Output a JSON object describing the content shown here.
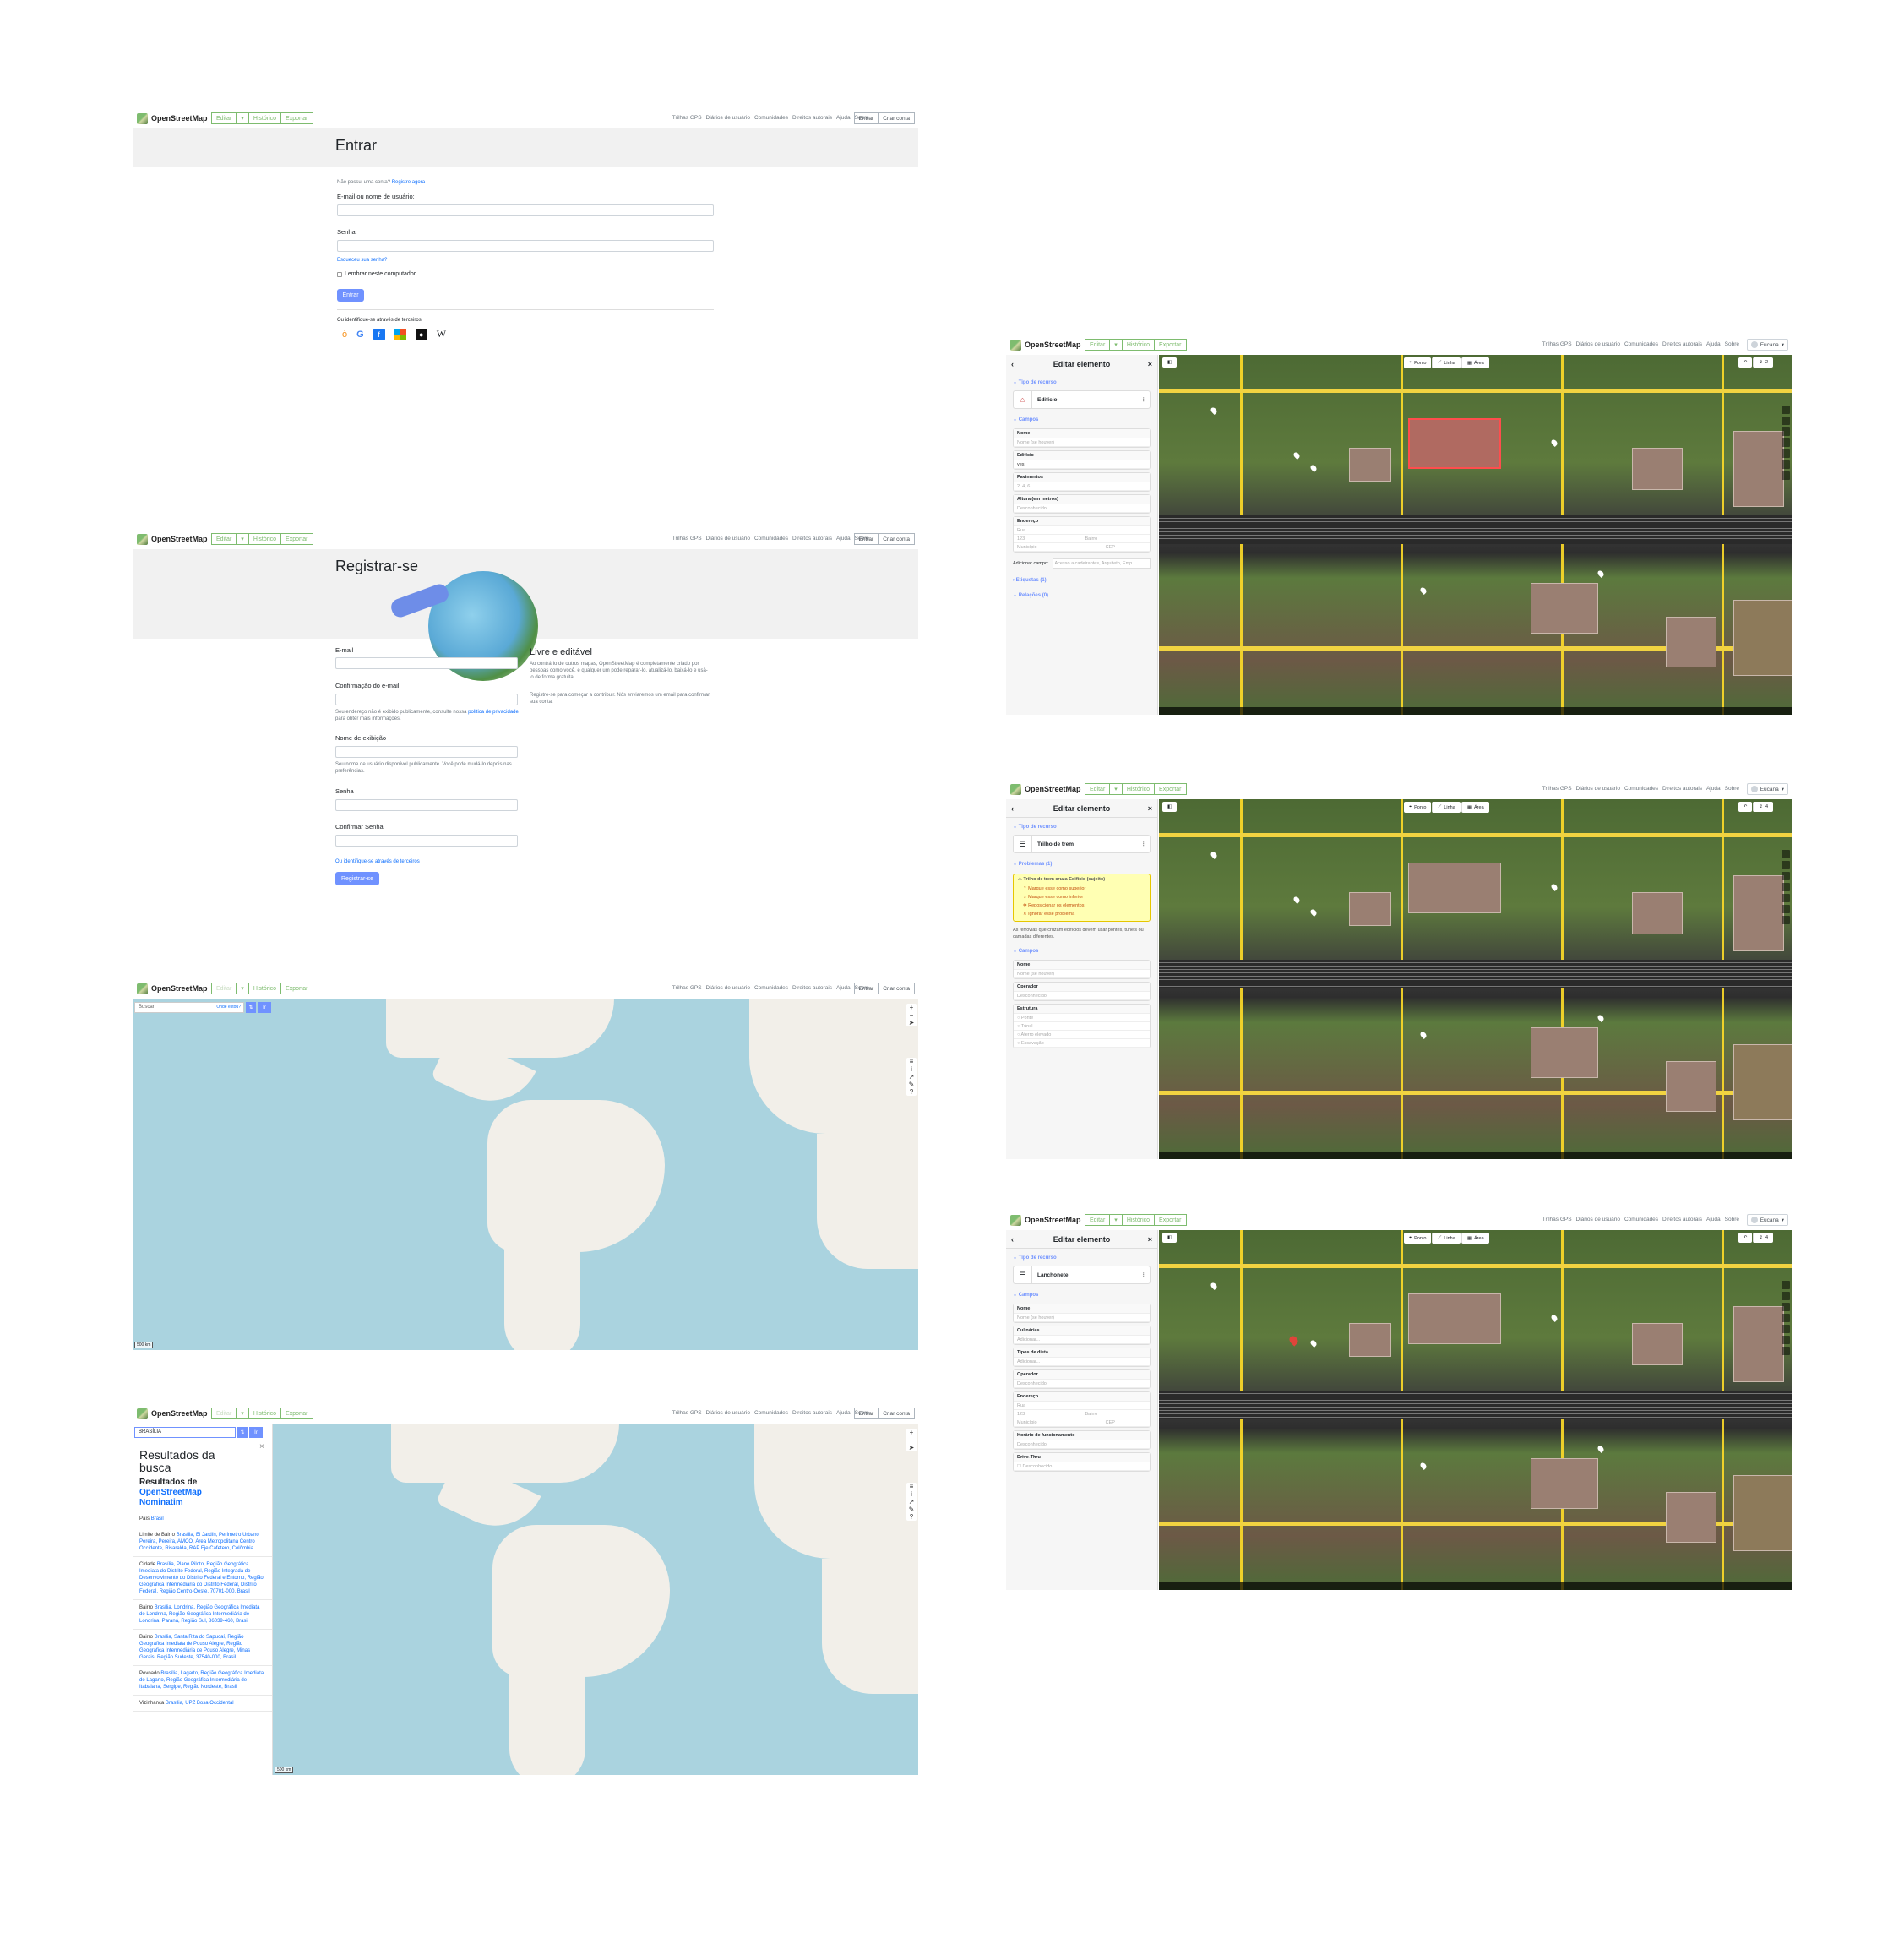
{
  "osm": {
    "brand": "OpenStreetMap",
    "edit": "Editar",
    "history": "Histórico",
    "export": "Exportar",
    "nav": [
      "Trilhas GPS",
      "Diários de usuário",
      "Comunidades",
      "Direitos autorais",
      "Ajuda",
      "Sobre"
    ],
    "login": "Entrar",
    "create_account": "Criar conta",
    "user": "Eucana"
  },
  "login_page": {
    "title": "Entrar",
    "no_account": "Não possui uma conta?",
    "register_now": "Registre agora",
    "email_label": "E-mail ou nome de usuário:",
    "password_label": "Senha:",
    "forgot": "Esqueceu sua senha?",
    "remember": "Lembrar neste computador",
    "submit": "Entrar",
    "third_party": "Ou identifique-se através de terceiros:"
  },
  "register_page": {
    "title": "Registrar-se",
    "email_label": "E-mail",
    "confirm_email_label": "Confirmação do e-mail",
    "email_help": "Seu endereço não é exibido publicamente, consulte nossa",
    "privacy_link": "política de privacidade",
    "email_help2": "para obter mais informações.",
    "display_name_label": "Nome de exibição",
    "display_name_help": "Seu nome de usuário disponível publicamente. Você pode mudá-lo depois nas preferências.",
    "password_label": "Senha",
    "confirm_password_label": "Confirmar Senha",
    "third_party": "Ou identifique-se através de terceiros",
    "submit": "Registrar-se",
    "aside_title": "Livre e editável",
    "aside_p1": "Ao contrário de outros mapas, OpenStreetMap é completamente criado por pessoas como você, e qualquer um pode reparar-lo, atualizá-lo, baixá-lo e usá-lo de forma gratuita.",
    "aside_p2": "Registre-se para começar a contribuir. Nós enviaremos um email para confirmar sua conta."
  },
  "map_page": {
    "search_placeholder": "Buscar",
    "where_am_i": "Onde estou?",
    "go": "Ir",
    "scale": "500 km"
  },
  "search_page": {
    "query": "BRASÍLIA",
    "go": "Ir",
    "heading": "Resultados da busca",
    "source_prefix": "Resultados de",
    "source": "OpenStreetMap Nominatim",
    "results": [
      {
        "type": "País",
        "text": "Brasil"
      },
      {
        "type": "Limite de Bairro",
        "text": "Brasília, El Jardín, Perímetro Urbano Pereira, Pereira, AMCO, Área Metropolitana Centro Occidente, Risaralda, RAP Eje Cafetero, Colômbia"
      },
      {
        "type": "Cidade",
        "text": "Brasília, Plano Piloto, Região Geográfica Imediata do Distrito Federal, Região Integrada de Desenvolvimento do Distrito Federal e Entorno, Região Geográfica Intermediária do Distrito Federal, Distrito Federal, Região Centro-Oeste, 70701-000, Brasil"
      },
      {
        "type": "Bairro",
        "text": "Brasília, Londrina, Região Geográfica Imediata de Londrina, Região Geográfica Intermediária de Londrina, Paraná, Região Sul, 86039-460, Brasil"
      },
      {
        "type": "Bairro",
        "text": "Brasília, Santa Rita do Sapucaí, Região Geográfica Imediata de Pouso Alegre, Região Geográfica Intermediária de Pouso Alegre, Minas Gerais, Região Sudeste, 37540-000, Brasil"
      },
      {
        "type": "Povoado",
        "text": "Brasília, Lagarto, Região Geográfica Imediata de Lagarto, Região Geográfica Intermediária de Itabaiana, Sergipe, Região Nordeste, Brasil"
      },
      {
        "type": "Vizinhança",
        "text": "Brasília, UPZ Bosa Occidental"
      }
    ],
    "scale": "500 km"
  },
  "editor": {
    "title": "Editar elemento",
    "feature_type": "Tipo de recurso",
    "fields": "Campos",
    "point": "Ponto",
    "line": "Linha",
    "area": "Área",
    "save": "Salvar",
    "undo": "Desfazer",
    "add_element": "Adicionar elemento",
    "building_panel": {
      "preset": "Edifício",
      "name_label": "Nome",
      "name_placeholder": "Nome (se houver)",
      "building_label": "Edifício",
      "building_value": "yes",
      "levels_label": "Pavimentos",
      "levels_placeholder": "2, 4, 6...",
      "height_label": "Altura (em metros)",
      "height_placeholder": "Desconhecido",
      "address_label": "Endereço",
      "street_placeholder": "Rua",
      "number_placeholder": "123",
      "neighbourhood_placeholder": "Bairro",
      "city_placeholder": "Município",
      "postcode_placeholder": "CEP",
      "add_field_label": "Adicionar campo:",
      "add_field_placeholder": "Acesso a cadeirantes, Arquiteto, Emp...",
      "tags": "Etiquetas (1)",
      "relations": "Relações (0)",
      "save_count": "2"
    },
    "rail_panel": {
      "preset": "Trilho de trem",
      "issues": "Problemas (1)",
      "issue_title": "Trilho de trem cruza Edifício (sujeito)",
      "fixes": [
        "Marque esse como superior",
        "Marque esse como inferior",
        "Reposicionar os elementos",
        "Ignorar esse problema"
      ],
      "issue_help": "As ferrovias que cruzam edifícios devem usar pontes, túneis ou camadas diferentes.",
      "name_label": "Nome",
      "name_placeholder": "Nome (se houver)",
      "operator_label": "Operador",
      "operator_placeholder": "Desconhecido",
      "structure_label": "Estrutura",
      "structures": [
        "Ponte",
        "Túnel",
        "Aterro elevado",
        "Escavação"
      ],
      "save_count": "4"
    },
    "snack_panel": {
      "preset": "Lanchonete",
      "name_label": "Nome",
      "name_placeholder": "Nome (se houver)",
      "cuisine_label": "Culinárias",
      "cuisine_placeholder": "Adicionar...",
      "diet_label": "Tipos de dieta",
      "diet_placeholder": "Adicionar...",
      "operator_label": "Operador",
      "operator_placeholder": "Desconhecido",
      "address_label": "Endereço",
      "street_placeholder": "Rua",
      "number_placeholder": "123",
      "neighbourhood_placeholder": "Bairro",
      "city_placeholder": "Município",
      "postcode_placeholder": "CEP",
      "hours_label": "Horário de funcionamento",
      "hours_placeholder": "Desconhecido",
      "drive_label": "Drive-Thru",
      "drive_value": "Desconhecido",
      "save_count": "4"
    }
  },
  "colors": {
    "osm_green": "#7ebc6f",
    "primary": "#7092ff",
    "ocean": "#aad3df",
    "land": "#f2efe9"
  }
}
